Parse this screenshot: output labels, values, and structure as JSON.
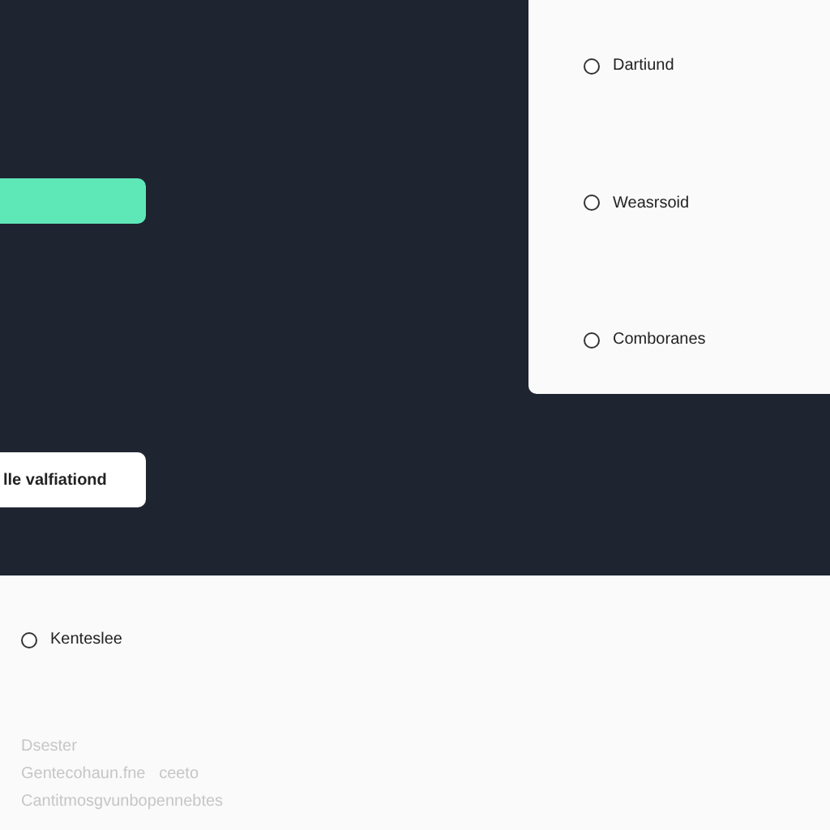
{
  "options_card": {
    "options": [
      {
        "label": "Dartiund",
        "selected": false
      },
      {
        "label": "Weasrsoid",
        "selected": false
      },
      {
        "label": "Comboranes",
        "selected": false
      }
    ]
  },
  "action_button": {
    "label": "lle valfiationd"
  },
  "lower_panel": {
    "option": {
      "label": "Kenteslee",
      "selected": false
    },
    "notes": [
      "Dsester",
      "Gentecohaun.fne   ceeto",
      "Cantitmosgvunbopennebtes"
    ]
  }
}
